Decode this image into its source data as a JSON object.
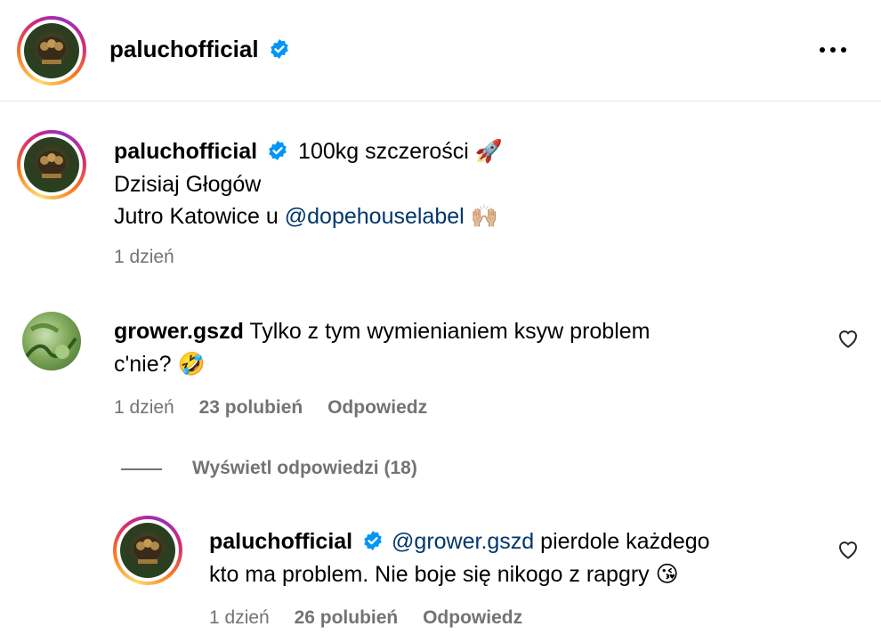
{
  "header": {
    "username": "paluchofficial",
    "more_icon": "more-horizontal-icon"
  },
  "caption": {
    "username": "paluchofficial",
    "line1": "100kg szczerości",
    "line1_emoji": "🚀",
    "line2": "Dzisiaj Głogów",
    "line3_prefix": "Jutro Katowice u ",
    "line3_mention": "@dopehouselabel",
    "line3_emoji": "🙌🏼",
    "time": "1 dzień"
  },
  "comment1": {
    "username": "grower.gszd",
    "text_line1": "Tylko z tym wymienianiem ksyw problem",
    "text_line2": "c'nie?",
    "emoji": "🤣",
    "time": "1 dzień",
    "likes": "23 polubień",
    "reply": "Odpowiedz",
    "view_replies": "Wyświetl odpowiedzi (18)"
  },
  "reply1": {
    "username": "paluchofficial",
    "mention": "@grower.gszd",
    "text_line1": " pierdole każdego",
    "text_line2": "kto ma problem. Nie boje się nikogo z rapgry",
    "emoji": "😘",
    "time": "1 dzień",
    "likes": "26 polubień",
    "reply": "Odpowiedz"
  },
  "colors": {
    "verified": "#0095f6",
    "link": "#00376b",
    "meta": "#737373"
  }
}
